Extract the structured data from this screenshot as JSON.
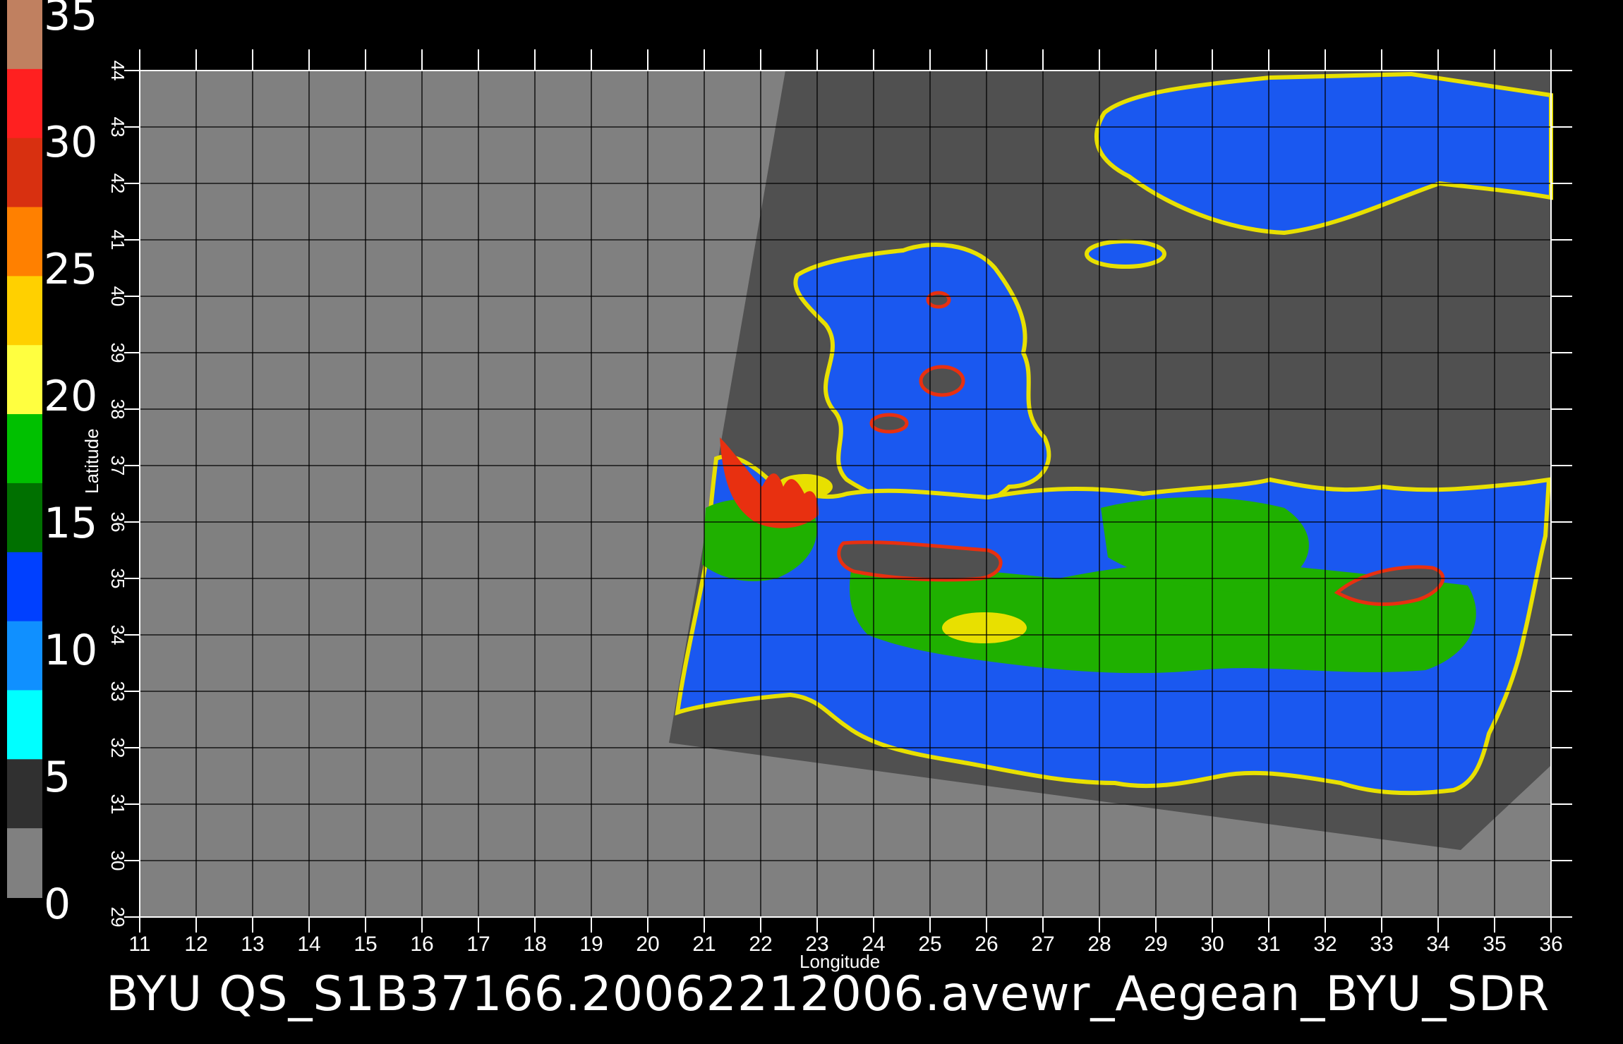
{
  "colorbar": {
    "labels": [
      "35",
      "30",
      "25",
      "20",
      "15",
      "10",
      "5",
      "0"
    ],
    "colors": [
      "#c08060",
      "#ff2020",
      "#d83010",
      "#ff8000",
      "#ffd000",
      "#ffff40",
      "#00c000",
      "#007000",
      "#0040ff",
      "#1090ff",
      "#00ffff",
      "#303030",
      "#808080"
    ]
  },
  "map": {
    "x_axis": {
      "title": "Longitude",
      "ticks": [
        "11",
        "12",
        "13",
        "14",
        "15",
        "16",
        "17",
        "18",
        "19",
        "20",
        "21",
        "22",
        "23",
        "24",
        "25",
        "26",
        "27",
        "28",
        "29",
        "30",
        "31",
        "32",
        "33",
        "34",
        "35",
        "36"
      ]
    },
    "y_axis": {
      "title": "Latitude",
      "ticks": [
        "29",
        "30",
        "31",
        "32",
        "33",
        "34",
        "35",
        "36",
        "37",
        "38",
        "39",
        "40",
        "41",
        "42",
        "43",
        "44"
      ]
    },
    "colors": {
      "land": "#808080",
      "swath": "#505050",
      "sea_blue": "#1a58f0",
      "sea_green": "#1fb000",
      "yellow": "#e8e000",
      "red": "#e83010"
    }
  },
  "caption": "BYU  QS_S1B37166.20062212006.avewr_Aegean_BYU_SDR"
}
